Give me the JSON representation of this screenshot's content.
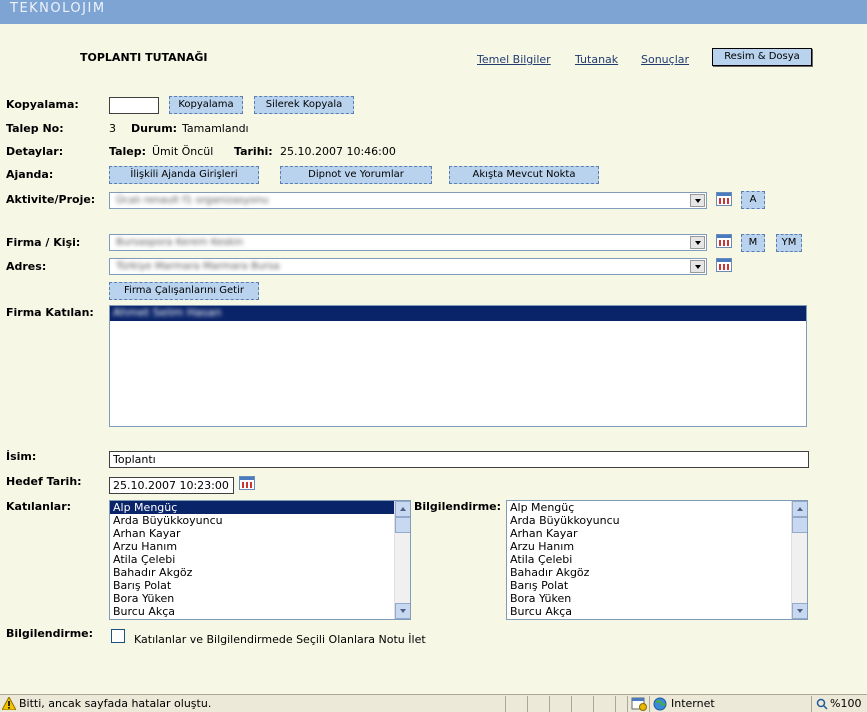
{
  "header": {
    "brand": "TEKNOLOJIM"
  },
  "page": {
    "title": "TOPLANTI TUTANAĞI",
    "nav": [
      "Temel Bilgiler",
      "Tutanak",
      "Sonuçlar",
      "Resim & Dosya"
    ]
  },
  "form": {
    "kopyalama": {
      "label": "Kopyalama:",
      "value": "",
      "btn_copy": "Kopyalama",
      "btn_delete_copy": "Silerek Kopyala"
    },
    "talep_no": {
      "label": "Talep No:",
      "value": "3",
      "durum_label": "Durum:",
      "durum_value": "Tamamlandı"
    },
    "detaylar": {
      "label": "Detaylar:",
      "talep_label": "Talep:",
      "talep_value": "Ümit Öncül",
      "tarih_label": "Tarihi:",
      "tarih_value": "25.10.2007 10:46:00"
    },
    "ajanda": {
      "label": "Ajanda:",
      "buttons": [
        "İlişkili Ajanda Girişleri",
        "Dipnot ve Yorumlar",
        "Akışta Mevcut Nokta"
      ]
    },
    "aktivite": {
      "label": "Aktivite/Proje:",
      "value": "Ücalı renault f1 organizasyonu",
      "btn": "A"
    },
    "firma": {
      "label": "Firma / Kişi:",
      "value": "Bursaspora Kerem Keskin",
      "btn_m": "M",
      "btn_ym": "YM"
    },
    "adres": {
      "label": "Adres:",
      "value": "Türkiye Marmara Marmara Bursa",
      "btn_getir": "Firma Çalışanlarını Getir"
    },
    "firma_katilan": {
      "label": "Firma Katılan:",
      "selected_item": "Ahmet Selim Hasan"
    },
    "isim": {
      "label": "İsim:",
      "value": "Toplantı"
    },
    "hedef_tarih": {
      "label": "Hedef Tarih:",
      "value": "25.10.2007 10:23:00"
    },
    "katilanlar": {
      "label": "Katılanlar:"
    },
    "bilgilendirme_list": {
      "label": "Bilgilendirme:"
    },
    "people": [
      "Alp Mengüç",
      "Arda Büyükkoyuncu",
      "Arhan Kayar",
      "Arzu Hanım",
      "Atila Çelebi",
      "Bahadır Akgöz",
      "Barış Polat",
      "Bora Yüken",
      "Burcu Akça"
    ],
    "bilgilendirme": {
      "label": "Bilgilendirme:",
      "checkbox_text": "Katılanlar ve Bilgilendirmede Seçili Olanlara Notu İlet"
    }
  },
  "statusbar": {
    "message": "Bitti, ancak sayfada hatalar oluştu.",
    "zone": "Internet",
    "zoom": "%100"
  }
}
